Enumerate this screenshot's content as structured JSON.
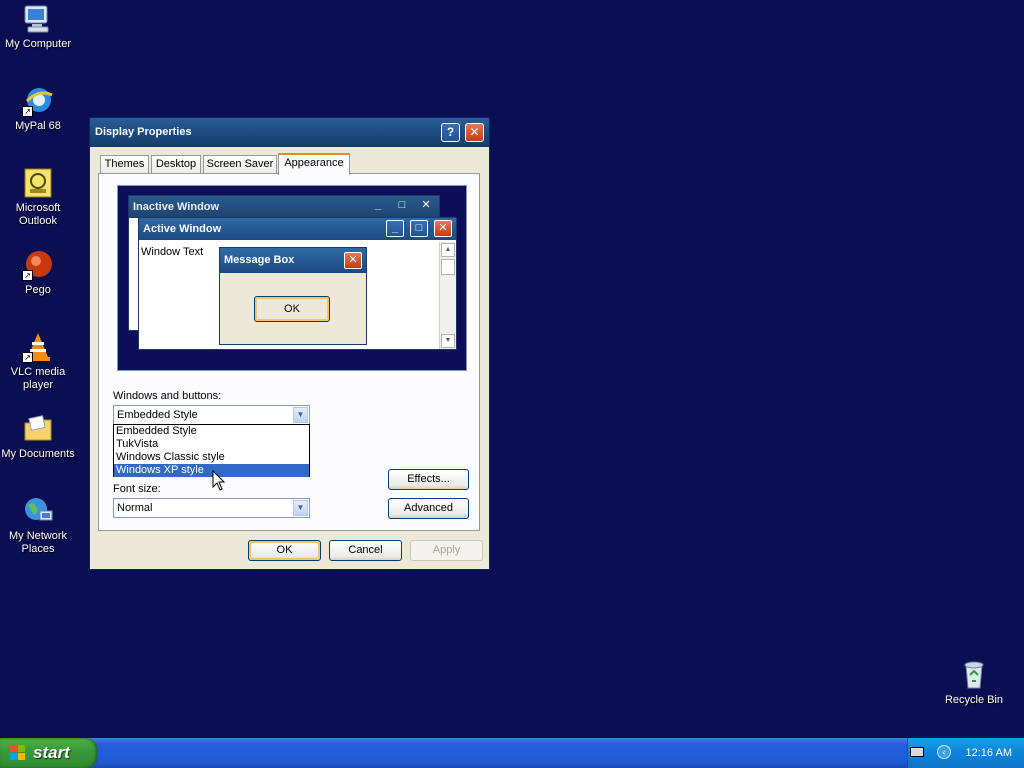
{
  "desktop": {
    "icons": [
      {
        "label": "My Computer"
      },
      {
        "label": "MyPal 68"
      },
      {
        "label": "Microsoft Outlook"
      },
      {
        "label": "Pego"
      },
      {
        "label": "VLC media player"
      },
      {
        "label": "My Documents"
      },
      {
        "label": "My Network Places"
      },
      {
        "label": "Recycle Bin"
      }
    ]
  },
  "dialog": {
    "title": "Display Properties",
    "help_glyph": "?",
    "close_glyph": "✕",
    "tabs": [
      {
        "label": "Themes"
      },
      {
        "label": "Desktop"
      },
      {
        "label": "Screen Saver"
      },
      {
        "label": "Appearance",
        "active": true
      }
    ],
    "preview": {
      "inactive_title": "Inactive Window",
      "active_title": "Active Window",
      "window_text": "Window Text",
      "message_title": "Message Box",
      "message_ok": "OK"
    },
    "windows_buttons_label": "Windows and buttons:",
    "windows_buttons_value": "Embedded Style",
    "dropdown_options": [
      "Embedded Style",
      "TukVista",
      "Windows Classic style",
      "Windows XP style"
    ],
    "dropdown_selected_index": 3,
    "font_size_label": "Font size:",
    "font_size_value": "Normal",
    "effects_button": "Effects...",
    "advanced_button": "Advanced",
    "ok_button": "OK",
    "cancel_button": "Cancel",
    "apply_button": "Apply"
  },
  "taskbar": {
    "start_label": "start",
    "clock": "12:16 AM"
  },
  "colors": {
    "desktop_bg": "#0a0e52",
    "title_bar": "#1e4c80",
    "selection": "#316ac5",
    "start_green": "#3b9a3b",
    "taskbar_blue": "#245edb"
  }
}
